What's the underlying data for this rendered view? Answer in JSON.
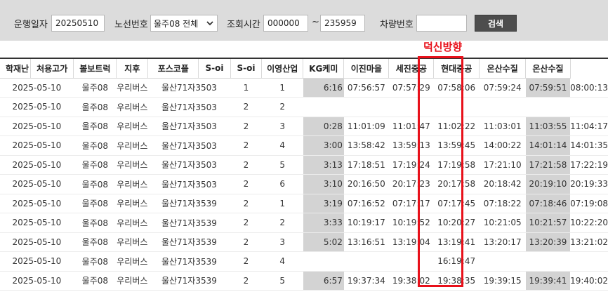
{
  "filters": {
    "date_label": "운행일자",
    "date_value": "20250510",
    "route_label": "노선번호",
    "route_value": "울주08 전체",
    "time_label": "조회시간",
    "time_from": "000000",
    "time_sep": "~",
    "time_to": "235959",
    "vehicle_label": "차량번호",
    "vehicle_value": "",
    "search_label": "검색"
  },
  "annotation": "덕신방향",
  "colors": {
    "annotation": "#e8101a",
    "highlight_border": "#e8101a",
    "gray_cell": "#d3d3d3"
  },
  "headers": [
    "학재난",
    "처용고가",
    "볼보트럭",
    "지후",
    "포스코플",
    "S-oi",
    "S-oi",
    "이영산업",
    "KG케미",
    "이진마을",
    "세진중공",
    "현대중공",
    "온산수질",
    "온산수질"
  ],
  "rows": [
    {
      "date": "2025-05-10",
      "route": "울주08",
      "company": "우리버스",
      "vehicle": "울산71자3503",
      "a": "1",
      "b": "1",
      "c": "6:16",
      "d": "07:56:57",
      "e": "07:57:29",
      "f": "07:58:06",
      "g": "07:59:24",
      "h": "07:59:51",
      "i": "08:00:13"
    },
    {
      "date": "2025-05-10",
      "route": "울주08",
      "company": "우리버스",
      "vehicle": "울산71자3503",
      "a": "2",
      "b": "2",
      "c": "",
      "d": "",
      "e": "",
      "f": "",
      "g": "",
      "h": "",
      "i": ""
    },
    {
      "date": "2025-05-10",
      "route": "울주08",
      "company": "우리버스",
      "vehicle": "울산71자3503",
      "a": "2",
      "b": "3",
      "c": "0:28",
      "d": "11:01:09",
      "e": "11:01:47",
      "f": "11:02:22",
      "g": "11:03:01",
      "h": "11:03:55",
      "i": "11:04:17"
    },
    {
      "date": "2025-05-10",
      "route": "울주08",
      "company": "우리버스",
      "vehicle": "울산71자3503",
      "a": "2",
      "b": "4",
      "c": "3:00",
      "d": "13:58:42",
      "e": "13:59:13",
      "f": "13:59:45",
      "g": "14:00:22",
      "h": "14:01:14",
      "i": "14:01:35"
    },
    {
      "date": "2025-05-10",
      "route": "울주08",
      "company": "우리버스",
      "vehicle": "울산71자3503",
      "a": "2",
      "b": "5",
      "c": "3:13",
      "d": "17:18:51",
      "e": "17:19:24",
      "f": "17:19:58",
      "g": "17:21:10",
      "h": "17:21:58",
      "i": "17:22:19"
    },
    {
      "date": "2025-05-10",
      "route": "울주08",
      "company": "우리버스",
      "vehicle": "울산71자3503",
      "a": "2",
      "b": "6",
      "c": "3:10",
      "d": "20:16:50",
      "e": "20:17:23",
      "f": "20:17:58",
      "g": "20:18:42",
      "h": "20:19:10",
      "i": "20:19:33"
    },
    {
      "date": "2025-05-10",
      "route": "울주08",
      "company": "우리버스",
      "vehicle": "울산71자3539",
      "a": "2",
      "b": "1",
      "c": "3:19",
      "d": "07:16:52",
      "e": "07:17:17",
      "f": "07:17:45",
      "g": "07:18:22",
      "h": "07:18:46",
      "i": "07:19:08"
    },
    {
      "date": "2025-05-10",
      "route": "울주08",
      "company": "우리버스",
      "vehicle": "울산71자3539",
      "a": "2",
      "b": "2",
      "c": "3:33",
      "d": "10:19:17",
      "e": "10:19:52",
      "f": "10:20:27",
      "g": "10:21:05",
      "h": "10:21:57",
      "i": "10:22:20"
    },
    {
      "date": "2025-05-10",
      "route": "울주08",
      "company": "우리버스",
      "vehicle": "울산71자3539",
      "a": "2",
      "b": "3",
      "c": "5:02",
      "d": "13:16:51",
      "e": "13:19:04",
      "f": "13:19:41",
      "g": "13:20:17",
      "h": "13:20:39",
      "i": "13:21:02"
    },
    {
      "date": "2025-05-10",
      "route": "울주08",
      "company": "우리버스",
      "vehicle": "울산71자3539",
      "a": "2",
      "b": "4",
      "c": "",
      "d": "",
      "e": "",
      "f": "16:19:47",
      "g": "",
      "h": "",
      "i": ""
    },
    {
      "date": "2025-05-10",
      "route": "울주08",
      "company": "우리버스",
      "vehicle": "울산71자3539",
      "a": "2",
      "b": "5",
      "c": "6:57",
      "d": "19:37:34",
      "e": "19:38:02",
      "f": "19:38:35",
      "g": "19:39:15",
      "h": "19:39:41",
      "i": "19:40:02"
    }
  ]
}
